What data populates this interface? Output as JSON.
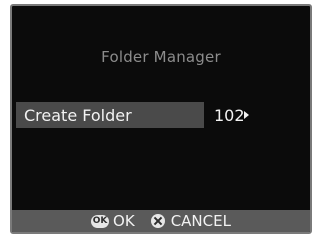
{
  "screen": {
    "title": "Folder Manager"
  },
  "menu": {
    "item_label": "Create Folder",
    "item_value": "102"
  },
  "bottom_bar": {
    "ok_icon_text": "OK",
    "ok_label": "OK",
    "cancel_label": "CANCEL",
    "ok_icon": "ok-button-icon",
    "cancel_icon": "cross-circle-icon"
  },
  "colors": {
    "screen_background": "#0b0b0b",
    "highlight": "#4a4a4a",
    "bottom_bar": "#5a5a5a",
    "title_text": "#8c8c8c",
    "text": "#f2f2f2"
  }
}
